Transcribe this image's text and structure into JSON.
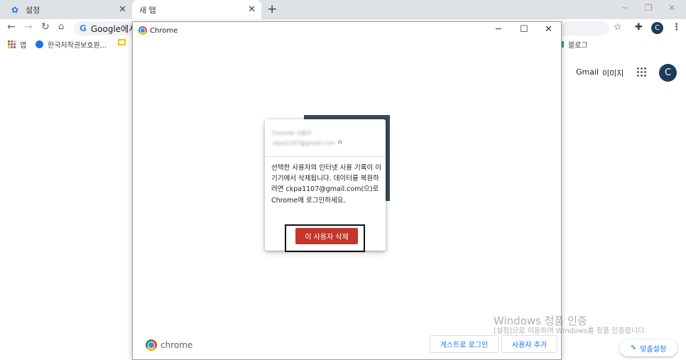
{
  "tabs": [
    {
      "label": "설정",
      "icon": "gear-icon"
    },
    {
      "label": "새 탭"
    }
  ],
  "toolbar": {
    "omnibox_text": "Google에서",
    "avatar_letter": "C"
  },
  "bookmarks": {
    "apps_label": "앱",
    "item1_label": "한국저작권보호원...",
    "blog_label": "블로그"
  },
  "page": {
    "gmail_label": "Gmail",
    "images_label": "이미지",
    "avatar_letter": "C"
  },
  "picker": {
    "title": "Chrome",
    "blurred_name": "Chrome 사용자",
    "blurred_email": "ckpa1107@gmail.com",
    "email_tail": "n",
    "message": "선택한 사용자의 인터넷 사용 기록이 이 기기에서 삭제됩니다. 데이터를 복원하려면 ckpa1107@gmail.com(으)로 Chrome에 로그인하세요.",
    "delete_button": "이 사용자 삭제",
    "footer_brand": "chrome",
    "guest_button": "게스트로 로그인",
    "add_user_button": "사용자 추가"
  },
  "watermark": {
    "title": "Windows 정품 인증",
    "subtitle": "[설정]으로 이동하여 Windows를 정품 인증합니다."
  },
  "customize": {
    "label": "맞춤설정"
  }
}
